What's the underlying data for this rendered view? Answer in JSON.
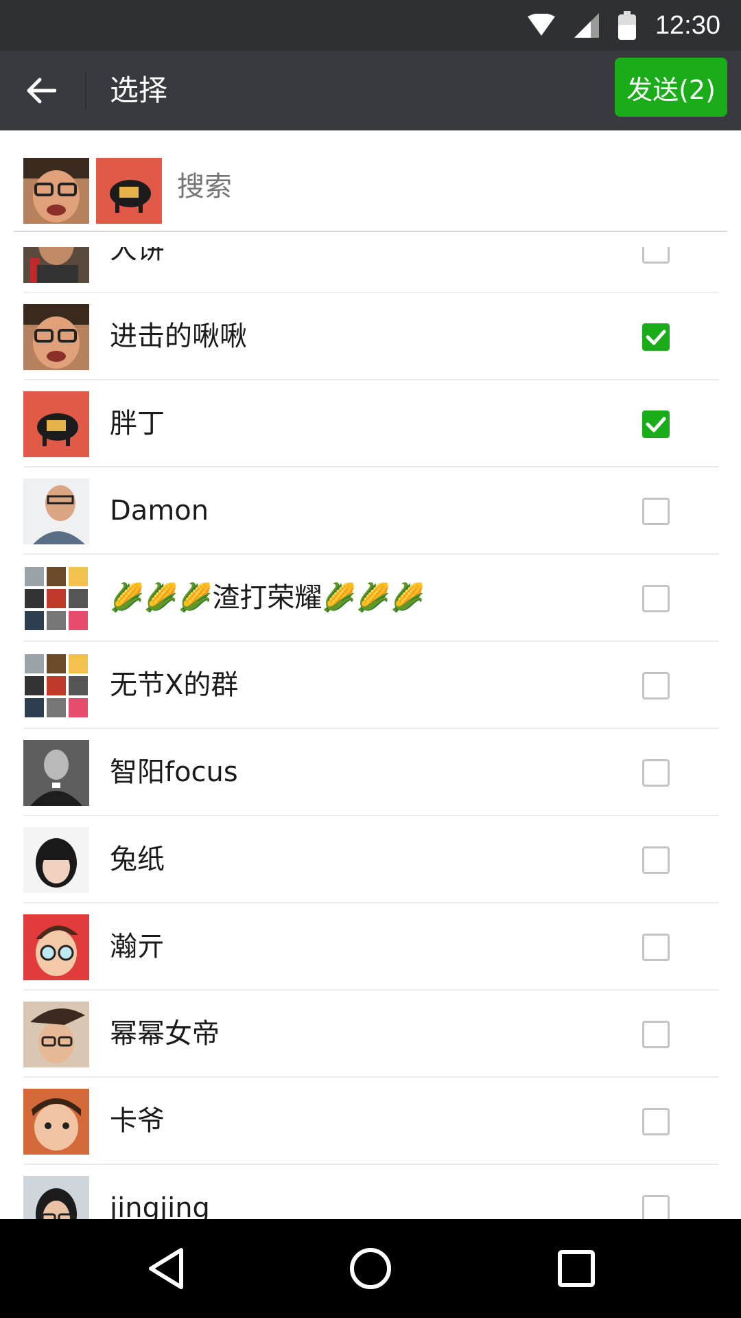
{
  "status_bar": {
    "time": "12:30"
  },
  "header": {
    "title": "选择",
    "send_label": "发送(2)"
  },
  "search": {
    "placeholder": "搜索"
  },
  "colors": {
    "accent": "#1aad19",
    "header_bg": "#393a3f",
    "status_bg": "#2e3033"
  },
  "contacts": [
    {
      "name": "大饼",
      "checked": false,
      "avatar": "avatar-guy-bottle"
    },
    {
      "name": "进击的啾啾",
      "checked": true,
      "avatar": "avatar-glasses-face"
    },
    {
      "name": "胖丁",
      "checked": true,
      "avatar": "avatar-pig"
    },
    {
      "name": "Damon",
      "checked": false,
      "avatar": "avatar-smiling-man"
    },
    {
      "name": "🌽🌽🌽渣打荣耀🌽🌽🌽",
      "checked": false,
      "avatar": "avatar-group-grid"
    },
    {
      "name": "无节X的群",
      "checked": false,
      "avatar": "avatar-group-grid"
    },
    {
      "name": "智阳focus",
      "checked": false,
      "avatar": "avatar-man-suit"
    },
    {
      "name": "兔纸",
      "checked": false,
      "avatar": "avatar-girl-bangs"
    },
    {
      "name": "瀚亓",
      "checked": false,
      "avatar": "avatar-cartoon"
    },
    {
      "name": "幂幂女帝",
      "checked": false,
      "avatar": "avatar-girl-glasses"
    },
    {
      "name": "卡爷",
      "checked": false,
      "avatar": "avatar-kid"
    },
    {
      "name": "jingjing",
      "checked": false,
      "avatar": "avatar-woman-glasses"
    }
  ]
}
